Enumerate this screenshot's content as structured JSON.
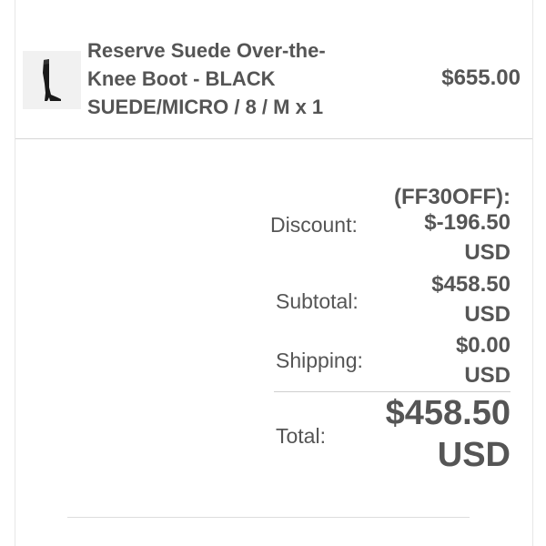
{
  "product": {
    "title_line1": "Reserve Suede Over-the-",
    "title_line2": "Knee Boot - BLACK",
    "title_line3": "SUEDE/MICRO / 8 / M x 1",
    "price": "$655.00",
    "thumbnail_icon": "over-the-knee-boot-icon"
  },
  "summary": {
    "discount_code": "(FF30OFF):",
    "discount_label": "Discount:",
    "discount_amount": "$-196.50",
    "discount_currency": "USD",
    "subtotal_label": "Subtotal:",
    "subtotal_amount": "$458.50",
    "subtotal_currency": "USD",
    "shipping_label": "Shipping:",
    "shipping_amount": "$0.00",
    "shipping_currency": "USD",
    "total_label": "Total:",
    "total_amount": "$458.50",
    "total_currency": "USD"
  },
  "colors": {
    "text": "#555555",
    "thumbnail_bg": "#f1f1f1",
    "divider": "#d6d6d6"
  }
}
